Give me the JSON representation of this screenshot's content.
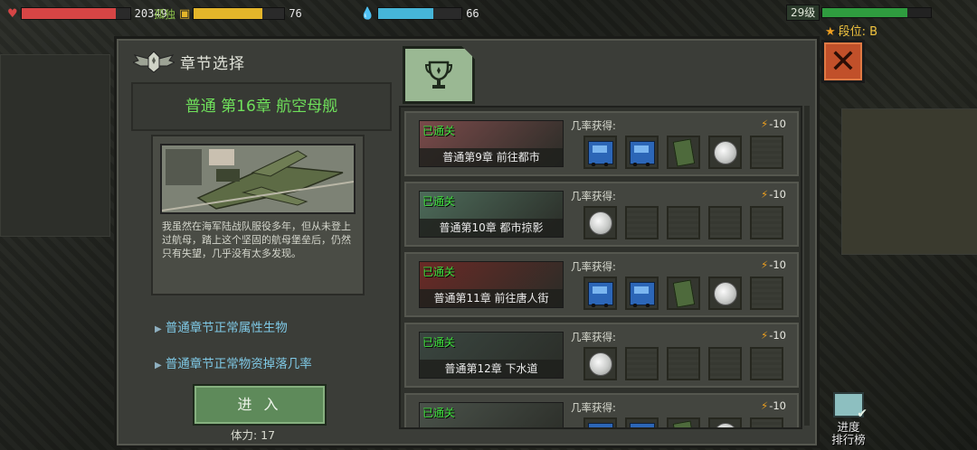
{
  "hud": {
    "hp": {
      "value": "20349",
      "fill": 0.87,
      "color": "#d64545"
    },
    "food": {
      "value": "76",
      "fill": 0.76,
      "color": "#e4b52a",
      "label": "孤独"
    },
    "water": {
      "value": "66",
      "fill": 0.66,
      "color": "#46b5d8"
    },
    "level": "29级",
    "level_fill": 0.78,
    "rank": "段位: B"
  },
  "panel": {
    "title": "章节选择",
    "close_icon": "close-icon"
  },
  "chapter": {
    "title": "普通 第16章 航空母舰",
    "description": "我虽然在海军陆战队服役多年，但从未登上过航母，踏上这个坚固的航母堡垒后，仍然只有失望，几乎没有太多发现。",
    "link1": "普通章节正常属性生物",
    "link2": "普通章节正常物资掉落几率",
    "enter_label": "进 入",
    "stamina": "体力: 17"
  },
  "list": [
    {
      "cleared": "已通关",
      "name": "普通第9章 前往都市",
      "rate_label": "几率获得:",
      "cost": "-10",
      "items": [
        "cart",
        "cart",
        "can",
        "coin",
        "empty"
      ],
      "thumb_color": "#7a4a4a"
    },
    {
      "cleared": "已通关",
      "name": "普通第10章 都市掠影",
      "rate_label": "几率获得:",
      "cost": "-10",
      "items": [
        "coin",
        "empty",
        "empty",
        "empty",
        "empty"
      ],
      "thumb_color": "#4d6b5a"
    },
    {
      "cleared": "已通关",
      "name": "普通第11章 前往唐人街",
      "rate_label": "几率获得:",
      "cost": "-10",
      "items": [
        "cart",
        "cart",
        "can",
        "coin",
        "empty"
      ],
      "thumb_color": "#6a2a26"
    },
    {
      "cleared": "已通关",
      "name": "普通第12章 下水道",
      "rate_label": "几率获得:",
      "cost": "-10",
      "items": [
        "coin",
        "empty",
        "empty",
        "empty",
        "empty"
      ],
      "thumb_color": "#3a4640"
    },
    {
      "cleared": "已通关",
      "name": "",
      "rate_label": "几率获得:",
      "cost": "-10",
      "items": [
        "cart",
        "cart",
        "can",
        "coin",
        "empty"
      ],
      "thumb_color": "#4a524a"
    }
  ],
  "ranking": {
    "line1": "进度",
    "line2": "排行榜"
  }
}
